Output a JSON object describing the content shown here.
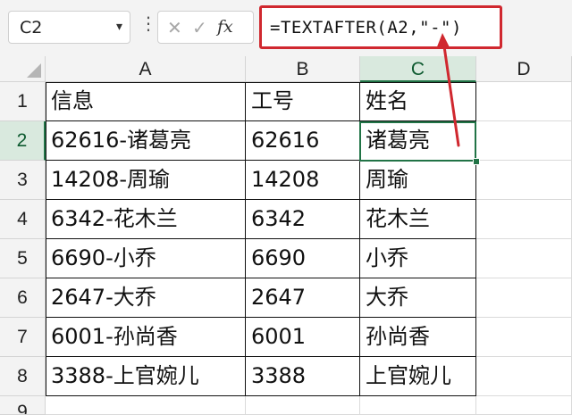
{
  "name_box": {
    "value": "C2"
  },
  "formula": {
    "text": "=TEXTAFTER(A2,\"-\")"
  },
  "columns": [
    "A",
    "B",
    "C",
    "D"
  ],
  "selected_column": "C",
  "selected_row": "2",
  "rows": [
    {
      "num": "1",
      "a": "信息",
      "b": "工号",
      "c": "姓名"
    },
    {
      "num": "2",
      "a": "62616-诸葛亮",
      "b": "62616",
      "c": "诸葛亮"
    },
    {
      "num": "3",
      "a": "14208-周瑜",
      "b": "14208",
      "c": "周瑜"
    },
    {
      "num": "4",
      "a": "6342-花木兰",
      "b": "6342",
      "c": "花木兰"
    },
    {
      "num": "5",
      "a": "6690-小乔",
      "b": "6690",
      "c": "小乔"
    },
    {
      "num": "6",
      "a": "2647-大乔",
      "b": "2647",
      "c": "大乔"
    },
    {
      "num": "7",
      "a": "6001-孙尚香",
      "b": "6001",
      "c": "孙尚香"
    },
    {
      "num": "8",
      "a": "3388-上官婉儿",
      "b": "3388",
      "c": "上官婉儿"
    },
    {
      "num": "9"
    }
  ],
  "colors": {
    "selection": "#217346",
    "highlight": "#d0282f"
  }
}
